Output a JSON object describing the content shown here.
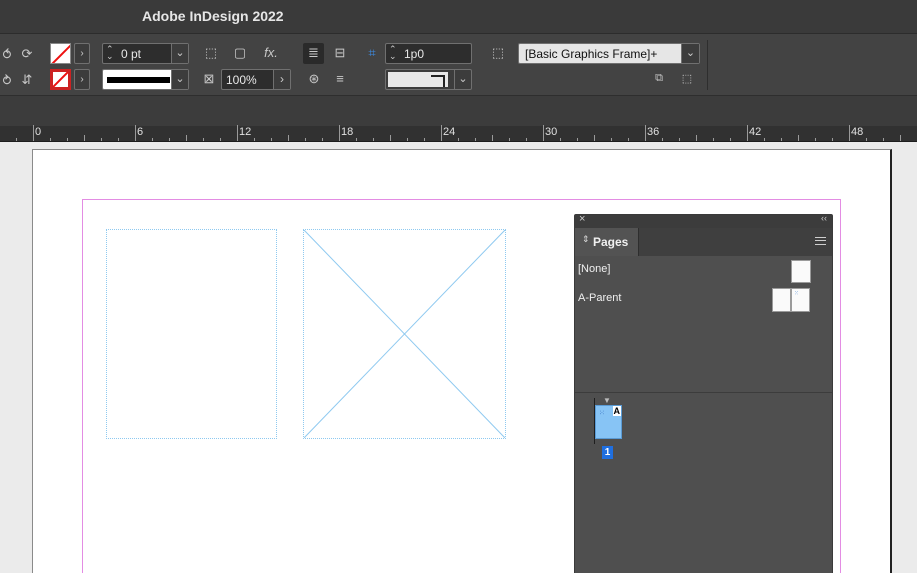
{
  "app": {
    "title": "Adobe InDesign 2022"
  },
  "controls": {
    "stroke_weight": "0 pt",
    "opacity": "100%",
    "fitting_offset": "1p0",
    "object_style": "[Basic Graphics Frame]+"
  },
  "ruler": {
    "labels": [
      "0",
      "6",
      "12",
      "18",
      "24",
      "30",
      "36",
      "42",
      "48"
    ]
  },
  "pages_panel": {
    "tab_label": "Pages",
    "parents": [
      "[None]",
      "A-Parent"
    ],
    "page_number": "1",
    "page_prefix": "A"
  },
  "colors": {
    "accent": "#1f6fe0",
    "margin": "#e38ce3",
    "frame": "#8ec9f0",
    "page_thumb": "#87c4f5"
  }
}
